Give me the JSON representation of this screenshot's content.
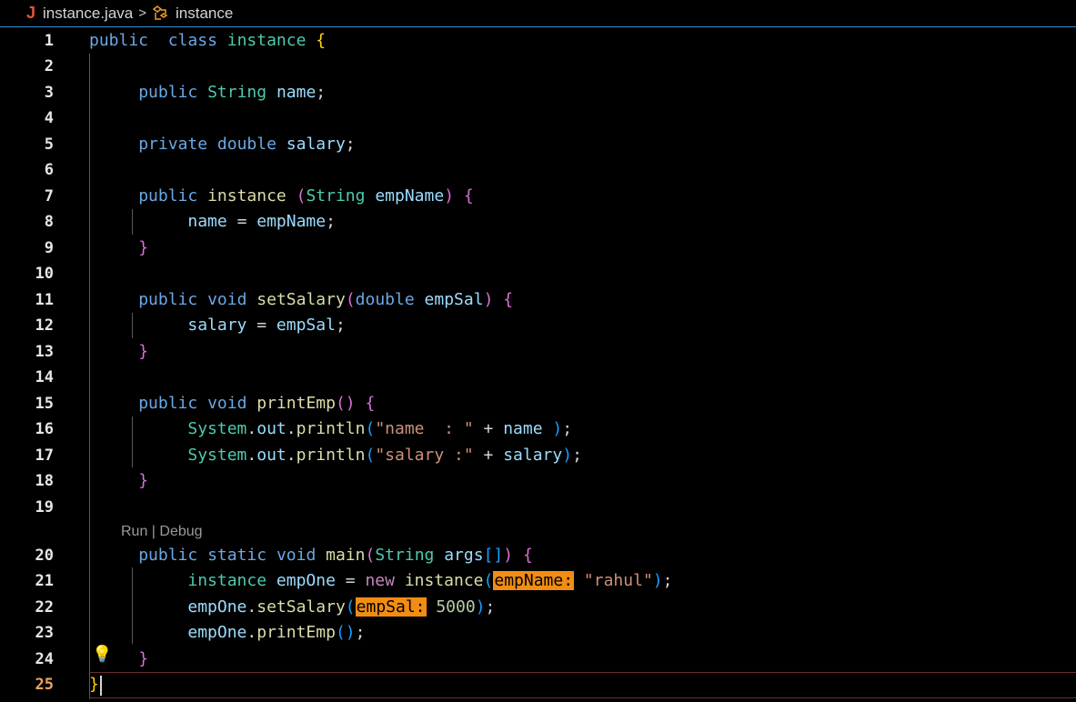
{
  "breadcrumb": {
    "file_icon": "J",
    "file_name": "instance.java",
    "separator": ">",
    "class_icon": "class-icon",
    "class_name": "instance"
  },
  "codelens": "Run | Debug",
  "lines": [
    {
      "n": "1",
      "tokens": [
        [
          "kw",
          "public"
        ],
        [
          "",
          "  "
        ],
        [
          "kw",
          "class"
        ],
        [
          "",
          " "
        ],
        [
          "ty",
          "instance"
        ],
        [
          "",
          " "
        ],
        [
          "b1",
          "{"
        ]
      ]
    },
    {
      "n": "2",
      "tokens": []
    },
    {
      "n": "3",
      "tokens": [
        [
          "",
          "     "
        ],
        [
          "kw",
          "public"
        ],
        [
          "",
          " "
        ],
        [
          "ty",
          "String"
        ],
        [
          "",
          " "
        ],
        [
          "vr",
          "name"
        ],
        [
          "",
          ";"
        ]
      ]
    },
    {
      "n": "4",
      "tokens": []
    },
    {
      "n": "5",
      "tokens": [
        [
          "",
          "     "
        ],
        [
          "kw",
          "private"
        ],
        [
          "",
          " "
        ],
        [
          "kw",
          "double"
        ],
        [
          "",
          " "
        ],
        [
          "vr",
          "salary"
        ],
        [
          "",
          ";"
        ]
      ]
    },
    {
      "n": "6",
      "tokens": []
    },
    {
      "n": "7",
      "tokens": [
        [
          "",
          "     "
        ],
        [
          "kw",
          "public"
        ],
        [
          "",
          " "
        ],
        [
          "fn",
          "instance"
        ],
        [
          "",
          " "
        ],
        [
          "b2",
          "("
        ],
        [
          "ty",
          "String"
        ],
        [
          "",
          " "
        ],
        [
          "vr",
          "empName"
        ],
        [
          "b2",
          ")"
        ],
        [
          "",
          " "
        ],
        [
          "b2",
          "{"
        ]
      ]
    },
    {
      "n": "8",
      "tokens": [
        [
          "",
          "          "
        ],
        [
          "vr",
          "name"
        ],
        [
          "",
          " = "
        ],
        [
          "vr",
          "empName"
        ],
        [
          "",
          ";"
        ]
      ]
    },
    {
      "n": "9",
      "tokens": [
        [
          "",
          "     "
        ],
        [
          "b2",
          "}"
        ]
      ]
    },
    {
      "n": "10",
      "tokens": []
    },
    {
      "n": "11",
      "tokens": [
        [
          "",
          "     "
        ],
        [
          "kw",
          "public"
        ],
        [
          "",
          " "
        ],
        [
          "kw",
          "void"
        ],
        [
          "",
          " "
        ],
        [
          "fn",
          "setSalary"
        ],
        [
          "b2",
          "("
        ],
        [
          "kw",
          "double"
        ],
        [
          "",
          " "
        ],
        [
          "vr",
          "empSal"
        ],
        [
          "b2",
          ")"
        ],
        [
          "",
          " "
        ],
        [
          "b2",
          "{"
        ]
      ]
    },
    {
      "n": "12",
      "tokens": [
        [
          "",
          "          "
        ],
        [
          "vr",
          "salary"
        ],
        [
          "",
          " = "
        ],
        [
          "vr",
          "empSal"
        ],
        [
          "",
          ";"
        ]
      ]
    },
    {
      "n": "13",
      "tokens": [
        [
          "",
          "     "
        ],
        [
          "b2",
          "}"
        ]
      ]
    },
    {
      "n": "14",
      "tokens": []
    },
    {
      "n": "15",
      "tokens": [
        [
          "",
          "     "
        ],
        [
          "kw",
          "public"
        ],
        [
          "",
          " "
        ],
        [
          "kw",
          "void"
        ],
        [
          "",
          " "
        ],
        [
          "fn",
          "printEmp"
        ],
        [
          "b2",
          "()"
        ],
        [
          "",
          " "
        ],
        [
          "b2",
          "{"
        ]
      ]
    },
    {
      "n": "16",
      "tokens": [
        [
          "",
          "          "
        ],
        [
          "ty",
          "System"
        ],
        [
          "",
          "."
        ],
        [
          "vr",
          "out"
        ],
        [
          "",
          "."
        ],
        [
          "fn",
          "println"
        ],
        [
          "b3",
          "("
        ],
        [
          "st",
          "\"name  : \""
        ],
        [
          "",
          " + "
        ],
        [
          "vr",
          "name"
        ],
        [
          "",
          " "
        ],
        [
          "b3",
          ")"
        ],
        [
          "",
          ";"
        ]
      ]
    },
    {
      "n": "17",
      "tokens": [
        [
          "",
          "          "
        ],
        [
          "ty",
          "System"
        ],
        [
          "",
          "."
        ],
        [
          "vr",
          "out"
        ],
        [
          "",
          "."
        ],
        [
          "fn",
          "println"
        ],
        [
          "b3",
          "("
        ],
        [
          "st",
          "\"salary :\""
        ],
        [
          "",
          " + "
        ],
        [
          "vr",
          "salary"
        ],
        [
          "b3",
          ")"
        ],
        [
          "",
          ";"
        ]
      ]
    },
    {
      "n": "18",
      "tokens": [
        [
          "",
          "     "
        ],
        [
          "b2",
          "}"
        ]
      ]
    },
    {
      "n": "19",
      "tokens": []
    },
    {
      "n": "20",
      "tokens": [
        [
          "",
          "     "
        ],
        [
          "kw",
          "public"
        ],
        [
          "",
          " "
        ],
        [
          "kw",
          "static"
        ],
        [
          "",
          " "
        ],
        [
          "kw",
          "void"
        ],
        [
          "",
          " "
        ],
        [
          "fn",
          "main"
        ],
        [
          "b2",
          "("
        ],
        [
          "ty",
          "String"
        ],
        [
          "",
          " "
        ],
        [
          "vr",
          "args"
        ],
        [
          "b3",
          "[]"
        ],
        [
          "b2",
          ")"
        ],
        [
          "",
          " "
        ],
        [
          "b2",
          "{"
        ]
      ]
    },
    {
      "n": "21",
      "tokens": [
        [
          "",
          "          "
        ],
        [
          "ty",
          "instance"
        ],
        [
          "",
          " "
        ],
        [
          "vr",
          "empOne"
        ],
        [
          "",
          " = "
        ],
        [
          "ctl",
          "new"
        ],
        [
          "",
          " "
        ],
        [
          "fn",
          "instance"
        ],
        [
          "b3",
          "("
        ],
        [
          "hint",
          "empName:"
        ],
        [
          "",
          " "
        ],
        [
          "st",
          "\"rahul\""
        ],
        [
          "b3",
          ")"
        ],
        [
          "",
          ";"
        ]
      ]
    },
    {
      "n": "22",
      "tokens": [
        [
          "",
          "          "
        ],
        [
          "vr",
          "empOne"
        ],
        [
          "",
          "."
        ],
        [
          "fn",
          "setSalary"
        ],
        [
          "b3",
          "("
        ],
        [
          "hint",
          "empSal:"
        ],
        [
          "",
          " "
        ],
        [
          "nm",
          "5000"
        ],
        [
          "b3",
          ")"
        ],
        [
          "",
          ";"
        ]
      ]
    },
    {
      "n": "23",
      "tokens": [
        [
          "",
          "          "
        ],
        [
          "vr",
          "empOne"
        ],
        [
          "",
          "."
        ],
        [
          "fn",
          "printEmp"
        ],
        [
          "b3",
          "()"
        ],
        [
          "",
          ";"
        ]
      ]
    },
    {
      "n": "24",
      "tokens": [
        [
          "",
          "     "
        ],
        [
          "b2",
          "}"
        ]
      ]
    },
    {
      "n": "25",
      "tokens": [
        [
          "b1",
          "}"
        ]
      ]
    }
  ],
  "colors": {
    "keyword": "#6aa8e6",
    "type": "#4ec9b0",
    "variable": "#9cdcfe",
    "function": "#dcdcaa",
    "string": "#ce9178",
    "inlay_hint_bg": "#f28c13",
    "active_line_number": "#f2a35e"
  }
}
